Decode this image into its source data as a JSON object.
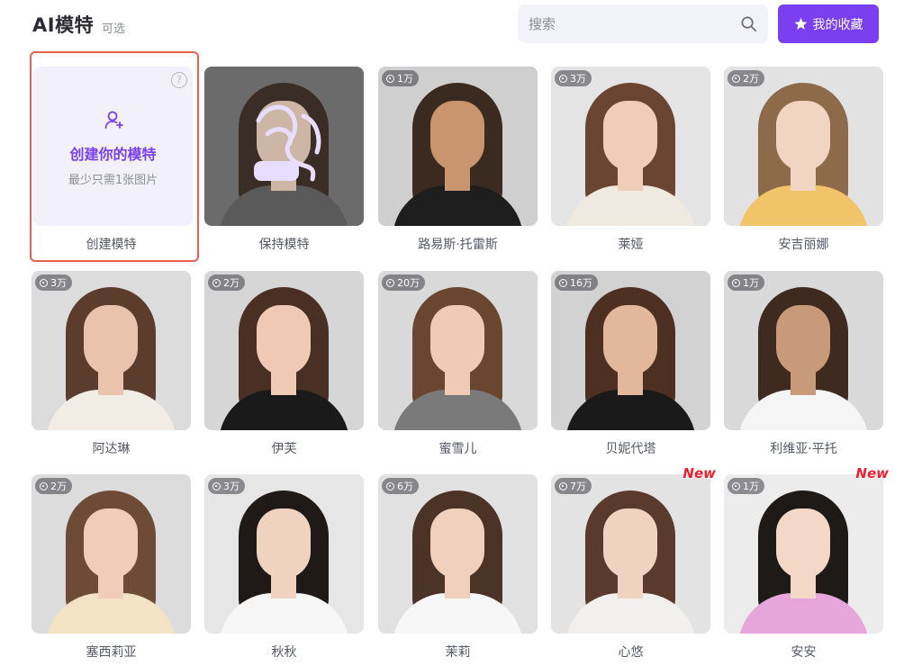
{
  "header": {
    "title": "AI模特",
    "subtitle": "可选",
    "search_placeholder": "搜索",
    "favorites_label": "我的收藏"
  },
  "create_card": {
    "title": "创建你的模特",
    "subtitle": "最少只需1张图片",
    "label": "创建模特",
    "help": "?"
  },
  "models": [
    {
      "name": "保持模特",
      "views": "",
      "is_new": false,
      "bg": "#6b6b6b",
      "hair": "#3a2d26",
      "skin": "#cdb6a6",
      "top": "#5a5a5a"
    },
    {
      "name": "路易斯·托雷斯",
      "views": "1万",
      "is_new": false,
      "bg": "#cfcfcf",
      "hair": "#3b2a20",
      "skin": "#c8956e",
      "top": "#1e1e1e"
    },
    {
      "name": "莱娅",
      "views": "3万",
      "is_new": false,
      "bg": "#e4e4e4",
      "hair": "#6a4632",
      "skin": "#efcdb8",
      "top": "#efe9e0"
    },
    {
      "name": "安吉丽娜",
      "views": "2万",
      "is_new": false,
      "bg": "#e2e2e2",
      "hair": "#8c6a4a",
      "skin": "#f1d4c2",
      "top": "#f2c46a"
    },
    {
      "name": "阿达琳",
      "views": "3万",
      "is_new": false,
      "bg": "#dcdcdc",
      "hair": "#5c3c2c",
      "skin": "#e9c3ab",
      "top": "#f1ede4"
    },
    {
      "name": "伊芙",
      "views": "2万",
      "is_new": false,
      "bg": "#d6d6d6",
      "hair": "#4a3024",
      "skin": "#efc9b3",
      "top": "#1a1a1a"
    },
    {
      "name": "蜜雪儿",
      "views": "20万",
      "is_new": false,
      "bg": "#d9d9d9",
      "hair": "#6a4530",
      "skin": "#efcab5",
      "top": "#7a7a7a"
    },
    {
      "name": "贝妮代塔",
      "views": "16万",
      "is_new": false,
      "bg": "#d2d2d2",
      "hair": "#4d3022",
      "skin": "#e3b79c",
      "top": "#1a1a1a"
    },
    {
      "name": "利维亚·平托",
      "views": "1万",
      "is_new": false,
      "bg": "#d9d9d9",
      "hair": "#3e2a1e",
      "skin": "#c99a7a",
      "top": "#f5f5f5"
    },
    {
      "name": "塞西莉亚",
      "views": "2万",
      "is_new": false,
      "bg": "#dcdcdc",
      "hair": "#6e4b36",
      "skin": "#efcdb9",
      "top": "#f1e3c4"
    },
    {
      "name": "秋秋",
      "views": "3万",
      "is_new": false,
      "bg": "#e6e6e6",
      "hair": "#1f1a17",
      "skin": "#efd2c0",
      "top": "#f6f6f6"
    },
    {
      "name": "茉莉",
      "views": "6万",
      "is_new": false,
      "bg": "#e1e1e1",
      "hair": "#4b3327",
      "skin": "#f0d0bd",
      "top": "#f7f7f7"
    },
    {
      "name": "心悠",
      "views": "7万",
      "is_new": true,
      "bg": "#e3e3e3",
      "hair": "#5a3a2c",
      "skin": "#f1d1c0",
      "top": "#f2f0ee"
    },
    {
      "name": "安安",
      "views": "1万",
      "is_new": true,
      "bg": "#ececec",
      "hair": "#1e1a18",
      "skin": "#f3d8c8",
      "top": "#e6a6d9"
    }
  ],
  "new_label": "New",
  "colors": {
    "accent": "#7a3ff0",
    "highlight_border": "#e8604f",
    "new_badge": "#e8232f"
  }
}
